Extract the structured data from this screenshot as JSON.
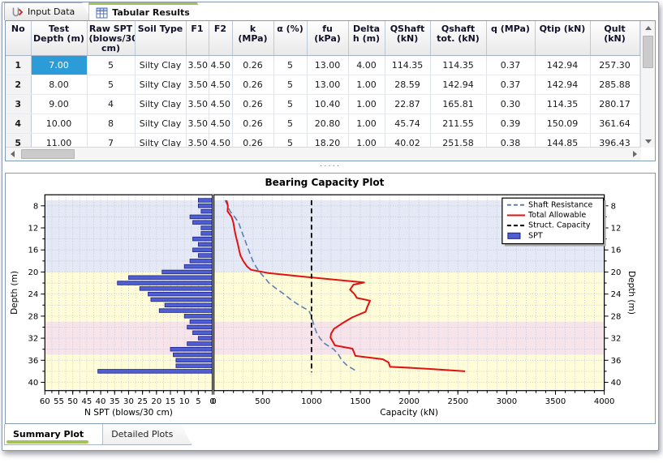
{
  "top_tabs": [
    {
      "label": "Input Data",
      "active": false
    },
    {
      "label": "Tabular Results",
      "active": true
    }
  ],
  "table": {
    "columns": [
      "No",
      "Test Depth (m)",
      "Raw SPT (blows/30 cm)",
      "Soil Type",
      "F1",
      "F2",
      "k (MPa)",
      "α (%)",
      "fu (kPa)",
      "Delta h (m)",
      "QShaft (kN)",
      "Qshaft tot. (kN)",
      "q (MPa)",
      "Qtip (kN)",
      "Qult (kN)"
    ],
    "rows": [
      [
        "1",
        "7.00",
        "5",
        "Silty Clay",
        "3.50",
        "4.50",
        "0.26",
        "5",
        "13.00",
        "4.00",
        "114.35",
        "114.35",
        "0.37",
        "142.94",
        "257.30"
      ],
      [
        "2",
        "8.00",
        "5",
        "Silty Clay",
        "3.50",
        "4.50",
        "0.26",
        "5",
        "13.00",
        "1.00",
        "28.59",
        "142.94",
        "0.37",
        "142.94",
        "285.88"
      ],
      [
        "3",
        "9.00",
        "4",
        "Silty Clay",
        "3.50",
        "4.50",
        "0.26",
        "5",
        "10.40",
        "1.00",
        "22.87",
        "165.81",
        "0.30",
        "114.35",
        "280.17"
      ],
      [
        "4",
        "10.00",
        "8",
        "Silty Clay",
        "3.50",
        "4.50",
        "0.26",
        "5",
        "20.80",
        "1.00",
        "45.74",
        "211.55",
        "0.39",
        "150.09",
        "361.64"
      ],
      [
        "5",
        "11.00",
        "7",
        "Silty Clay",
        "3.50",
        "4.50",
        "0.26",
        "5",
        "18.20",
        "1.00",
        "40.02",
        "251.58",
        "0.38",
        "144.85",
        "396.43"
      ]
    ],
    "selected_cell": {
      "row": 0,
      "col": 1
    }
  },
  "splitter": {
    "dots": "·····"
  },
  "bottom_tabs": [
    {
      "label": "Summary Plot",
      "active": true
    },
    {
      "label": "Detailed Plots",
      "active": false
    }
  ],
  "chart_data": {
    "type": "line",
    "title": "Bearing Capacity Plot",
    "ylabel": "Depth (m)",
    "ylim": [
      6,
      41.5
    ],
    "yticks": [
      8,
      12,
      16,
      20,
      24,
      28,
      32,
      36,
      40
    ],
    "left_plot": {
      "xlabel": "N SPT (blows/30 cm)",
      "xlim": [
        60,
        0
      ],
      "ticks": [
        60,
        55,
        50,
        45,
        40,
        35,
        30,
        25,
        20,
        15,
        10,
        5,
        0
      ]
    },
    "right_plot": {
      "xlabel": "Capacity (kN)",
      "xlim": [
        0,
        4000
      ],
      "ticks": [
        0,
        500,
        1000,
        1500,
        2000,
        2500,
        3000,
        3500,
        4000
      ]
    },
    "bands": [
      {
        "from": 7,
        "to": 20,
        "color": "#e5e9f5"
      },
      {
        "from": 20,
        "to": 29,
        "color": "#fffcd8"
      },
      {
        "from": 29,
        "to": 35,
        "color": "#f7e4ea"
      },
      {
        "from": 35,
        "to": 41.2,
        "color": "#fffcd8"
      }
    ],
    "spt_bars": {
      "name": "SPT",
      "color": "#4f5fd2",
      "border": "#1c2487",
      "data": [
        [
          7,
          5
        ],
        [
          8,
          5
        ],
        [
          9,
          4
        ],
        [
          10,
          8
        ],
        [
          11,
          7
        ],
        [
          12,
          4
        ],
        [
          13,
          4
        ],
        [
          14,
          7
        ],
        [
          15,
          5
        ],
        [
          16,
          7
        ],
        [
          17,
          5
        ],
        [
          18,
          8
        ],
        [
          19,
          10
        ],
        [
          20,
          18
        ],
        [
          21,
          30
        ],
        [
          22,
          34
        ],
        [
          23,
          26
        ],
        [
          24,
          23
        ],
        [
          25,
          22
        ],
        [
          26,
          17
        ],
        [
          27,
          19
        ],
        [
          28,
          10
        ],
        [
          29,
          8
        ],
        [
          30,
          9
        ],
        [
          31,
          7
        ],
        [
          32,
          5
        ],
        [
          33,
          9
        ],
        [
          34,
          15
        ],
        [
          35,
          14
        ],
        [
          36,
          13
        ],
        [
          37,
          13
        ],
        [
          38,
          41
        ]
      ]
    },
    "series": [
      {
        "name": "Shaft Resistance",
        "color": "#5b80b2",
        "dash": "7,4",
        "width": 1.6,
        "points": [
          [
            7,
            114
          ],
          [
            8,
            143
          ],
          [
            9,
            166
          ],
          [
            10,
            212
          ],
          [
            11,
            252
          ],
          [
            12,
            272
          ],
          [
            13,
            292
          ],
          [
            14,
            314
          ],
          [
            15,
            334
          ],
          [
            16,
            355
          ],
          [
            17,
            377
          ],
          [
            18,
            399
          ],
          [
            19,
            430
          ],
          [
            20,
            468
          ],
          [
            21,
            518
          ],
          [
            22,
            566
          ],
          [
            23,
            638
          ],
          [
            24,
            718
          ],
          [
            25,
            788
          ],
          [
            26,
            872
          ],
          [
            27,
            972
          ],
          [
            28,
            1000
          ],
          [
            29,
            1014
          ],
          [
            30,
            1032
          ],
          [
            31,
            1052
          ],
          [
            32,
            1086
          ],
          [
            33,
            1136
          ],
          [
            34,
            1228
          ],
          [
            35,
            1278
          ],
          [
            36,
            1310
          ],
          [
            37,
            1368
          ],
          [
            37.9,
            1458
          ]
        ]
      },
      {
        "name": "Total Allowable",
        "color": "#e11212",
        "dash": "",
        "width": 2,
        "points": [
          [
            7,
            129
          ],
          [
            8,
            143
          ],
          [
            9,
            140
          ],
          [
            10,
            181
          ],
          [
            11,
            198
          ],
          [
            12,
            208
          ],
          [
            13,
            218
          ],
          [
            14,
            232
          ],
          [
            15,
            246
          ],
          [
            16,
            258
          ],
          [
            17,
            272
          ],
          [
            18,
            300
          ],
          [
            19,
            340
          ],
          [
            19.6,
            380
          ],
          [
            20.2,
            560
          ],
          [
            20.8,
            890
          ],
          [
            21.9,
            1540
          ],
          [
            22.3,
            1430
          ],
          [
            23.2,
            1395
          ],
          [
            24,
            1440
          ],
          [
            24.7,
            1465
          ],
          [
            25.2,
            1600
          ],
          [
            26.4,
            1570
          ],
          [
            27.2,
            1555
          ],
          [
            28.2,
            1420
          ],
          [
            29.2,
            1325
          ],
          [
            30.3,
            1230
          ],
          [
            31.2,
            1200
          ],
          [
            31.9,
            1195
          ],
          [
            33.3,
            1240
          ],
          [
            33.9,
            1420
          ],
          [
            35.2,
            1450
          ],
          [
            35.8,
            1730
          ],
          [
            36.4,
            1790
          ],
          [
            37.2,
            1805
          ],
          [
            37.35,
            1990
          ],
          [
            37.6,
            2230
          ],
          [
            38,
            2575
          ]
        ]
      },
      {
        "name": "Struct. Capacity",
        "color": "#000000",
        "dash": "6,4",
        "width": 1.8,
        "points": [
          [
            7,
            1000
          ],
          [
            38.2,
            1000
          ]
        ]
      }
    ],
    "legend": [
      {
        "label": "Shaft Resistance",
        "swatch": "dash",
        "color": "#5b80b2"
      },
      {
        "label": "Total Allowable",
        "swatch": "solid",
        "color": "#e11212"
      },
      {
        "label": "Struct. Capacity",
        "swatch": "dash",
        "color": "#000000"
      },
      {
        "label": "SPT",
        "swatch": "rect",
        "color": "#4f5fd2"
      }
    ],
    "legend_position": "top-right",
    "grid": true
  }
}
